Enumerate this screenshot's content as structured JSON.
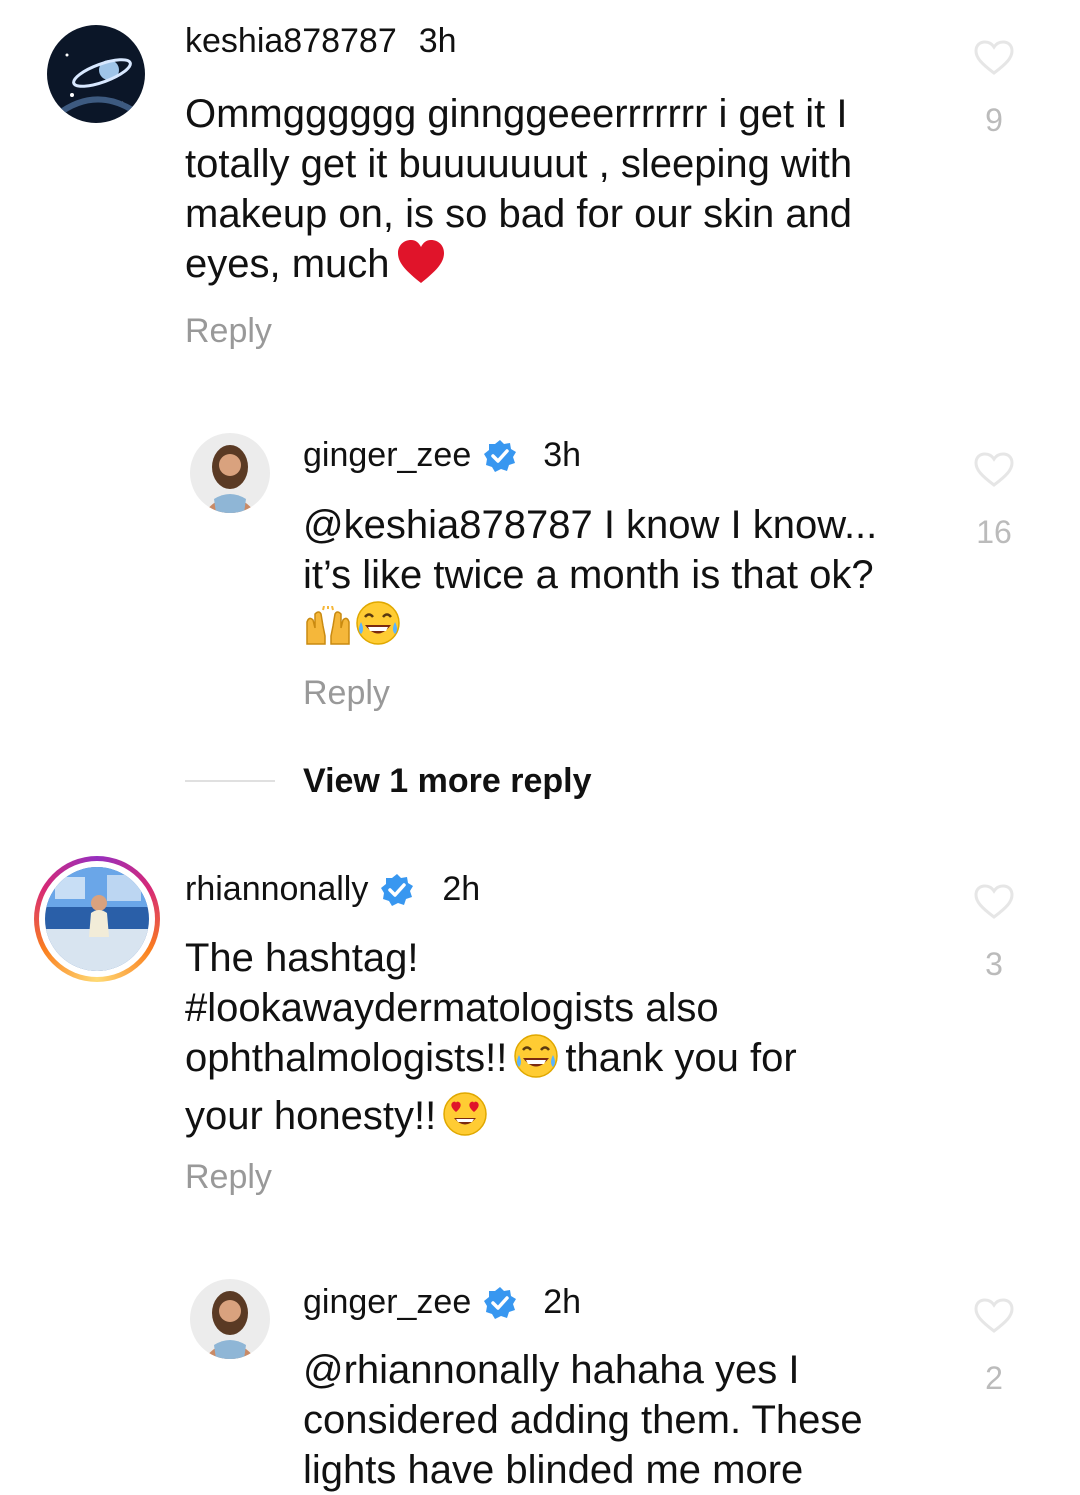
{
  "colors": {
    "verified": "#3897f0",
    "muted": "#999999",
    "like_count": "#bbbbbb",
    "story_ring": [
      "#feda75",
      "#fa7e1e",
      "#d62976",
      "#962fbf"
    ]
  },
  "comments": [
    {
      "username": "keshia878787",
      "time": "3h",
      "verified": false,
      "lines": [
        "Ommgggggg ginnggeeerrrrrrr i get it I",
        "totally get it buuuuuuut , sleeping with",
        "makeup on, is so bad for our skin and",
        "eyes, much"
      ],
      "emoji": "red-heart",
      "reply_label": "Reply",
      "likes": "9"
    },
    {
      "username": "ginger_zee",
      "time": "3h",
      "verified": true,
      "lines": [
        "@keshia878787 I know I know...",
        "it’s like twice a month is that ok?"
      ],
      "emoji": "raising-hands, tears-of-joy",
      "reply_label": "Reply",
      "likes": "16"
    },
    {
      "view_more": "View 1 more reply"
    },
    {
      "username": "rhiannonally",
      "time": "2h",
      "verified": true,
      "lines": [
        "The hashtag!",
        "#lookawaydermatologists also",
        "ophthalmologists!!",
        "thank you for",
        "your honesty!!"
      ],
      "emoji": "tears-of-joy, heart-eyes",
      "reply_label": "Reply",
      "likes": "3"
    },
    {
      "username": "ginger_zee",
      "time": "2h",
      "verified": true,
      "lines": [
        "@rhiannonally hahaha yes I",
        "considered adding them. These",
        "lights have blinded me more"
      ],
      "reply_label": "",
      "likes": "2"
    }
  ]
}
